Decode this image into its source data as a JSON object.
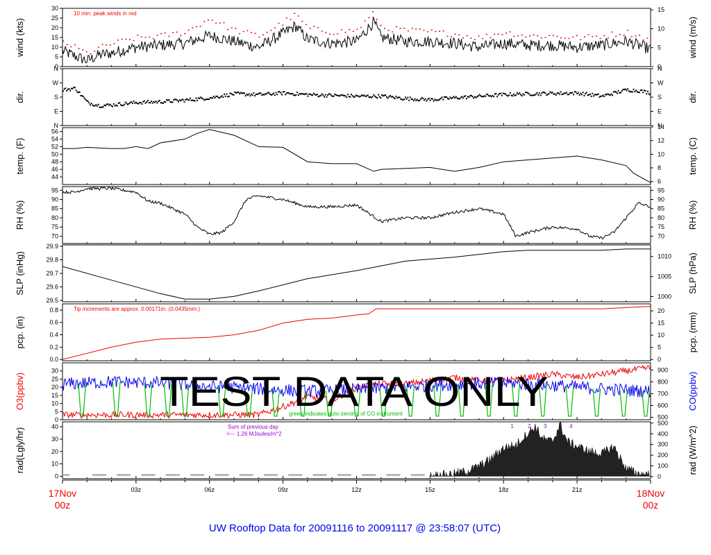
{
  "footer_title": "UW Rooftop Data for 20091116  to  20091117 @ 23:58:07  (UTC)",
  "watermark": "TEST   DATA   ONLY",
  "time_axis": {
    "start_day": "17Nov",
    "start_hour": "00z",
    "end_day": "18Nov",
    "end_hour": "00z",
    "ticks": [
      "03z",
      "06z",
      "09z",
      "12z",
      "15z",
      "18z",
      "21z"
    ],
    "label_color": "#ee0000"
  },
  "colors": {
    "black": "#000000",
    "red": "#ee0000",
    "blue": "#0000ee",
    "green": "#00bb00",
    "purple": "#9900cc",
    "grey": "#999999"
  },
  "chart_data": [
    {
      "id": "wind",
      "type": "line",
      "ylabel_left": "wind (kts)",
      "ylabel_right": "wind (m/s)",
      "ylim_left": [
        0,
        30
      ],
      "ylim_right": [
        0,
        15.4
      ],
      "ticks_left": [
        "0",
        "5",
        "10",
        "15",
        "20",
        "25",
        "30"
      ],
      "ticks_right": [
        "0",
        "5",
        "10",
        "15"
      ],
      "annotation": "10 min. peak winds in red",
      "series": [
        {
          "name": "wind speed",
          "color": "#000000",
          "style": "noisy",
          "x": [
            0,
            1,
            1.5,
            2,
            3,
            4,
            5,
            6,
            7,
            8,
            9,
            9.5,
            10,
            11,
            12,
            12.7,
            13,
            14,
            15,
            16,
            17,
            18,
            19,
            20,
            21,
            22,
            23,
            24
          ],
          "y": [
            8,
            3,
            6,
            7,
            10,
            11,
            12,
            16,
            13,
            10,
            17,
            21,
            14,
            12,
            13,
            23,
            15,
            13,
            13,
            12,
            10,
            12,
            11,
            11,
            10,
            11,
            13,
            9
          ],
          "noise": 3
        },
        {
          "name": "10 min. peak winds",
          "color": "#ee0000",
          "style": "dots",
          "x": [
            0,
            1,
            1.5,
            2,
            3,
            4,
            5,
            6,
            7,
            8,
            9,
            9.5,
            10,
            11,
            12,
            12.7,
            13,
            14,
            15,
            16,
            17,
            18,
            19,
            20,
            21,
            22,
            23,
            24
          ],
          "y": [
            13,
            7,
            10,
            12,
            15,
            16,
            18,
            25,
            19,
            16,
            23,
            27,
            20,
            18,
            19,
            28,
            20,
            19,
            18,
            17,
            15,
            18,
            16,
            16,
            15,
            16,
            18,
            14
          ]
        }
      ]
    },
    {
      "id": "dir",
      "type": "scatter",
      "ylabel_left": "dir.",
      "ylabel_right": "dir.",
      "ylim_left": [
        0,
        360
      ],
      "ylim_right": [
        0,
        360
      ],
      "ticks_left": [
        "N",
        "E",
        "S",
        "W",
        "N"
      ],
      "ticks_right": [
        "N",
        "E",
        "S",
        "W",
        "N"
      ],
      "series": [
        {
          "name": "wind direction",
          "color": "#000000",
          "style": "dots",
          "x": [
            0,
            0.5,
            1,
            1.5,
            2,
            3,
            4,
            5,
            6,
            7,
            8,
            9,
            10,
            11,
            12,
            13,
            14,
            15,
            16,
            17,
            18,
            19,
            20,
            21,
            22,
            23,
            23.5,
            24
          ],
          "y": [
            230,
            240,
            150,
            130,
            135,
            150,
            155,
            165,
            180,
            205,
            200,
            210,
            200,
            195,
            190,
            190,
            175,
            168,
            180,
            190,
            200,
            205,
            208,
            210,
            190,
            230,
            225,
            210
          ]
        }
      ]
    },
    {
      "id": "temp",
      "type": "line",
      "ylabel_left": "temp. (F)",
      "ylabel_right": "temp. (C)",
      "ylim_left": [
        42,
        57
      ],
      "ylim_right": [
        5.56,
        13.9
      ],
      "ticks_left": [
        "44",
        "46",
        "48",
        "50",
        "52",
        "54",
        "56"
      ],
      "ticks_right": [
        "6",
        "8",
        "10",
        "12",
        "14"
      ],
      "series": [
        {
          "name": "temperature",
          "color": "#000000",
          "style": "line",
          "x": [
            0,
            0.5,
            1,
            2,
            2.5,
            3,
            3.5,
            4,
            5,
            5.5,
            6,
            7,
            8,
            9,
            10,
            11,
            12,
            12.7,
            13,
            15,
            16,
            17,
            18,
            19,
            20,
            21,
            22,
            23,
            23.3,
            24
          ],
          "y": [
            51.5,
            51.5,
            51.8,
            51.5,
            51.5,
            52,
            51.5,
            53,
            54,
            55.5,
            56.5,
            55,
            52,
            51.8,
            48,
            47.5,
            47.5,
            45.5,
            46,
            46.5,
            45.5,
            46.5,
            48,
            48.5,
            49,
            49.5,
            48.5,
            47,
            45,
            42.5
          ]
        }
      ]
    },
    {
      "id": "rh",
      "type": "line",
      "ylabel_left": "RH (%)",
      "ylabel_right": "RH (%)",
      "ylim_left": [
        66,
        97
      ],
      "ylim_right": [
        66,
        97
      ],
      "ticks_left": [
        "70",
        "75",
        "80",
        "85",
        "90",
        "95"
      ],
      "ticks_right": [
        "70",
        "75",
        "80",
        "85",
        "90",
        "95"
      ],
      "series": [
        {
          "name": "relative humidity",
          "color": "#000000",
          "style": "line",
          "x": [
            0,
            0.5,
            1,
            2,
            3,
            3.5,
            4,
            5,
            5.5,
            6,
            6.5,
            7,
            7.5,
            8,
            9,
            10,
            11,
            12,
            13,
            14,
            15,
            16,
            17,
            18,
            18.5,
            19,
            20,
            21,
            21.5,
            22,
            22.5,
            23,
            23.5,
            24
          ],
          "y": [
            94,
            94,
            96,
            96,
            94,
            89,
            88,
            82,
            75,
            71,
            72,
            78,
            90,
            92,
            90,
            86,
            86,
            87,
            78,
            80,
            80,
            83,
            85,
            82,
            70,
            72,
            75,
            74,
            70,
            69,
            72,
            80,
            88,
            86
          ],
          "noise": 0.8
        }
      ]
    },
    {
      "id": "slp",
      "type": "line",
      "ylabel_left": "SLP (inHg)",
      "ylabel_right": "SLP (hPa)",
      "ylim_left": [
        29.49,
        29.91
      ],
      "ylim_right": [
        998.7,
        1012.9
      ],
      "ticks_left": [
        "29.5",
        "29.6",
        "29.7",
        "29.8",
        "29.9"
      ],
      "ticks_right": [
        "1000",
        "1005",
        "1010"
      ],
      "series": [
        {
          "name": "sea level pressure",
          "color": "#000000",
          "style": "line",
          "x": [
            0,
            2,
            4,
            5,
            6,
            7,
            8,
            10,
            12,
            14,
            16,
            18,
            19,
            20,
            22,
            23,
            24
          ],
          "y": [
            29.75,
            29.65,
            29.55,
            29.51,
            29.51,
            29.53,
            29.57,
            29.66,
            29.72,
            29.79,
            29.82,
            29.86,
            29.87,
            29.87,
            29.87,
            29.88,
            29.88
          ]
        }
      ]
    },
    {
      "id": "pcp",
      "type": "line",
      "ylabel_left": "pcp. (in)",
      "ylabel_right": "pcp. (mm)",
      "ylim_left": [
        -0.02,
        0.9
      ],
      "ylim_right": [
        -0.5,
        22.9
      ],
      "ticks_left": [
        "0.0",
        "0.2",
        "0.4",
        "0.6",
        "0.8"
      ],
      "ticks_right": [
        "0",
        "5",
        "10",
        "15",
        "20"
      ],
      "annotation": "Tip increments are approx. 0.00171in. (0.0435mm.)",
      "series": [
        {
          "name": "precipitation",
          "color": "#ee0000",
          "style": "line",
          "x": [
            0,
            1,
            2,
            3,
            4,
            6,
            7,
            8,
            9,
            10,
            11,
            12,
            12.5,
            12.8,
            14,
            16,
            18,
            20,
            22,
            24
          ],
          "y": [
            0,
            0.1,
            0.2,
            0.28,
            0.33,
            0.36,
            0.4,
            0.47,
            0.59,
            0.65,
            0.67,
            0.72,
            0.74,
            0.82,
            0.82,
            0.82,
            0.82,
            0.82,
            0.82,
            0.86
          ]
        }
      ]
    },
    {
      "id": "o3co",
      "type": "line",
      "ylabel_left": "O3(ppbv)",
      "ylabel_right": "CO(ppbv)",
      "ylim_left": [
        0,
        35
      ],
      "ylim_right": [
        480,
        960
      ],
      "ticks_left": [
        "0",
        "5",
        "10",
        "15",
        "20",
        "25",
        "30"
      ],
      "ticks_right": [
        "500",
        "600",
        "700",
        "800",
        "900"
      ],
      "annotation": "green indicates auto-zeroing of CO instrument",
      "series": [
        {
          "name": "O3",
          "color": "#ee0000",
          "style": "noisy",
          "x": [
            0,
            2,
            4,
            6,
            7,
            8,
            9,
            10,
            11,
            12,
            13,
            14,
            15,
            16,
            17,
            18,
            19,
            20,
            21,
            22,
            23,
            24
          ],
          "y": [
            3,
            3,
            3,
            3,
            3,
            3,
            8,
            14,
            12,
            20,
            22,
            22,
            24,
            26,
            24,
            24,
            26,
            28,
            26,
            28,
            30,
            32
          ],
          "noise": 2
        },
        {
          "name": "CO",
          "color": "#0000ee",
          "style": "noisy",
          "x": [
            0,
            2,
            4,
            6,
            8,
            10,
            12,
            14,
            16,
            18,
            20,
            22,
            24
          ],
          "y": [
            780,
            800,
            790,
            760,
            740,
            720,
            730,
            760,
            780,
            790,
            770,
            740,
            720
          ],
          "noise": 55
        },
        {
          "name": "CO auto-zero",
          "color": "#00bb00",
          "style": "dips",
          "x": [
            0.8,
            2.2,
            3.5,
            4.3,
            5.0,
            6.5,
            7.6,
            8.7,
            9.8,
            10.9,
            12.0,
            13.1,
            14.2,
            15.3,
            16.3,
            17.4,
            18.5,
            19.6,
            20.7,
            21.8,
            22.9,
            23.8
          ]
        }
      ]
    },
    {
      "id": "rad",
      "type": "area",
      "ylabel_left": "rad(Lgly/hr)",
      "ylabel_right": "rad (W/m^2)",
      "ylim_left": [
        -2,
        44
      ],
      "ylim_right": [
        -20,
        512
      ],
      "ticks_left": [
        "0",
        "10",
        "20",
        "30",
        "40"
      ],
      "ticks_right": [
        "0",
        "100",
        "200",
        "300",
        "400",
        "500"
      ],
      "annotation_lines": [
        "Sum of previous day",
        "<--- 1.26 MJoules/m^2"
      ],
      "markers": [
        "1",
        "2",
        "3",
        "4"
      ],
      "marker_x": [
        18.35,
        19.05,
        19.7,
        20.75
      ],
      "series": [
        {
          "name": "radiation",
          "color": "#222222",
          "style": "area",
          "x": [
            15,
            15.5,
            16,
            16.5,
            17,
            17.5,
            18,
            18.5,
            19,
            19.3,
            19.6,
            20,
            20.3,
            20.6,
            21,
            21.5,
            22,
            22.5,
            23,
            23.5,
            24
          ],
          "y": [
            0,
            1,
            2,
            4,
            8,
            14,
            23,
            25,
            35,
            40,
            30,
            28,
            42,
            28,
            24,
            20,
            18,
            24,
            6,
            2,
            1
          ],
          "noise": 4
        },
        {
          "name": "night baseline",
          "color": "#999999",
          "style": "baseline",
          "x": [
            0,
            1.5,
            2.5,
            3.5,
            4.5,
            5.5,
            6.5,
            7.5,
            8.5,
            9.5,
            10.5,
            11.5,
            12.5,
            13.5,
            14.5
          ],
          "y": [
            1,
            1,
            1,
            1,
            1,
            1,
            1,
            1,
            1,
            1,
            1,
            1,
            1,
            1,
            1
          ]
        }
      ]
    }
  ]
}
